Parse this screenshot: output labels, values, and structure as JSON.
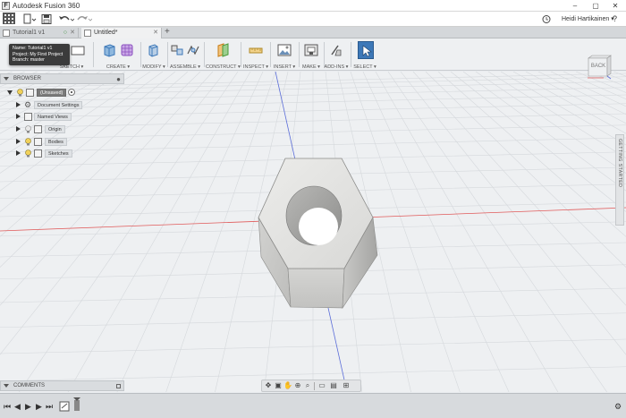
{
  "window": {
    "title": "Autodesk Fusion 360",
    "controls": {
      "minimize": "–",
      "maximize": "▢",
      "close": "✕"
    }
  },
  "quick_access": {
    "user_name": "Heidi Hartikainen",
    "user_dropdown": "▾",
    "help": "?",
    "icons": [
      "data-panel-icon",
      "file-menu-icon",
      "save-icon",
      "undo-icon",
      "redo-icon",
      "job-status-icon",
      "help-icon"
    ]
  },
  "tabs": [
    {
      "label": "Tutorial1 v1",
      "active": false
    },
    {
      "label": "Untitled*",
      "active": true
    }
  ],
  "tooltip": {
    "name": "Name: Tutorial1 v1",
    "project": "Project: My First Project",
    "branch": "Branch: master"
  },
  "toolbar": {
    "groups": [
      {
        "label": "SKETCH ▾"
      },
      {
        "label": "CREATE ▾"
      },
      {
        "label": "MODIFY ▾"
      },
      {
        "label": "ASSEMBLE ▾"
      },
      {
        "label": "CONSTRUCT ▾"
      },
      {
        "label": "INSPECT ▾"
      },
      {
        "label": "INSERT ▾"
      },
      {
        "label": "MAKE ▾"
      },
      {
        "label": "ADD-INS ▾"
      },
      {
        "label": "SELECT ▾"
      }
    ]
  },
  "browser": {
    "header": "BROWSER",
    "items": [
      {
        "label": "(Unsaved)",
        "expanded": true,
        "root": true
      },
      {
        "label": "Document Settings"
      },
      {
        "label": "Named Views"
      },
      {
        "label": "Origin"
      },
      {
        "label": "Bodies"
      },
      {
        "label": "Sketches"
      }
    ]
  },
  "viewcube": {
    "face_label": "BACK"
  },
  "getting_started": {
    "label": "GETTING STARTED"
  },
  "comments": {
    "header": "COMMENTS"
  },
  "colors": {
    "accent_blue": "#3d78b8",
    "x_axis_red": "#e05a5a",
    "y_axis_blue": "#5a6cd8",
    "grid_line": "#d5d8dc",
    "nut_face_light": "#e4e4e2",
    "nut_face_mid": "#c9c9c7",
    "nut_face_dark": "#a8a8a6"
  }
}
